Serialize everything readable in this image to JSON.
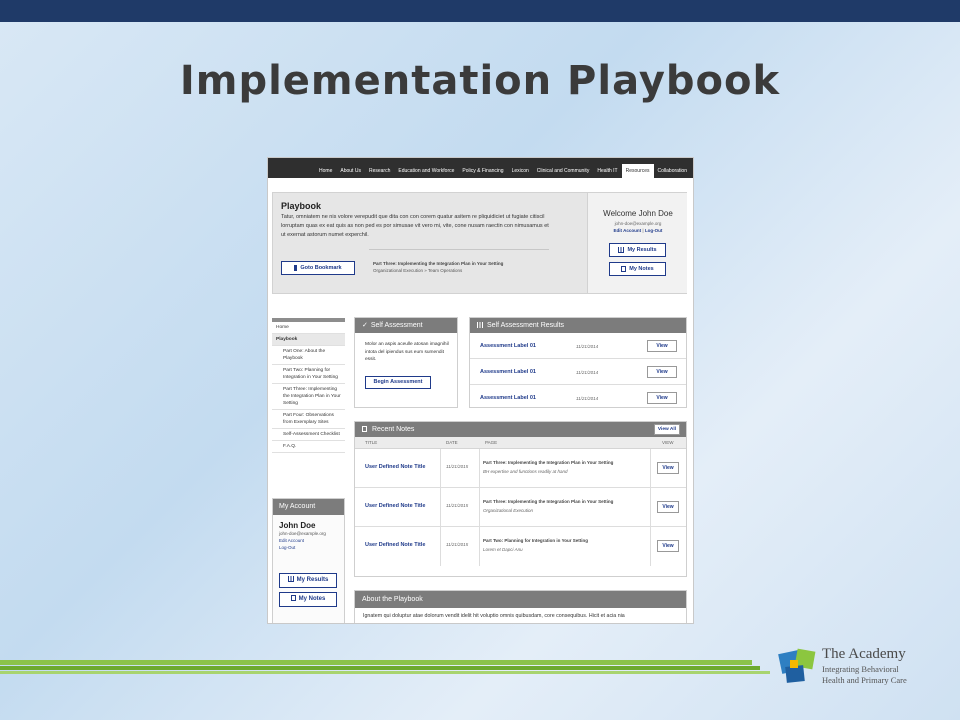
{
  "slide": {
    "title": "Implementation Playbook"
  },
  "nav": {
    "items": [
      "Home",
      "About Us",
      "Research",
      "Education and Workforce",
      "Policy & Financing",
      "Lexicon",
      "Clinical and Community",
      "Health IT",
      "Resources",
      "Collaboration"
    ],
    "active": "Resources"
  },
  "hero": {
    "title": "Playbook",
    "text": "Tatur, omniatem ne nis volore verepudit que dita con con corem quatur asitem re pliquidiciet ut fugiate citiscil lorruptam quas ex eat quis as non ped es por simusae vit vero mi, vite, cone nusam raectin con nimusamus et ut exernat astorum numet experchil.",
    "goto_bookmark": "Goto Bookmark",
    "bookmark_part": "Part Three: Implementing the Integration Plan in Your Setting",
    "bookmark_sub": "Organizational Execution » Team Operations"
  },
  "welcome": {
    "greeting": "Welcome John Doe",
    "email": "john-doe@example.org",
    "edit_account": "Edit Account",
    "separator": "|",
    "log_out": "Log-Out",
    "my_results": "My Results",
    "my_notes": "My Notes"
  },
  "sidebar": {
    "items": [
      {
        "label": "Home"
      },
      {
        "label": "Playbook"
      },
      {
        "label": "Part One: About the Playbook"
      },
      {
        "label": "Part Two: Planning for Integration in Your Setting"
      },
      {
        "label": "Part Three: Implementing the Integration Plan in Your Setting"
      },
      {
        "label": "Part Four: Observations from Exemplary Sites"
      },
      {
        "label": "Self-Assessment Checklist"
      },
      {
        "label": "F.A.Q."
      }
    ]
  },
  "account": {
    "heading": "My Account",
    "name": "John Doe",
    "email": "john-doe@example.org",
    "edit_account": "Edit Account",
    "log_out": "Log-Out",
    "my_results": "My Results",
    "my_notes": "My Notes"
  },
  "self_assessment": {
    "heading": "Self Assessment",
    "text": "Molor an aspis aceulle atosan imagnihil intota del ipiendus sus eum sumendit essit.",
    "button": "Begin Assessment"
  },
  "results": {
    "heading": "Self Assessment Results",
    "rows": [
      {
        "label": "Assessment Label 01",
        "date": "11/21/2014",
        "button": "View"
      },
      {
        "label": "Assessment Label 01",
        "date": "11/21/2014",
        "button": "View"
      },
      {
        "label": "Assessment Label 01",
        "date": "11/21/2014",
        "button": "View"
      }
    ]
  },
  "notes": {
    "heading": "Recent Notes",
    "view_all": "View All",
    "columns": [
      "TITLE",
      "DATE",
      "PAGE",
      "VIEW"
    ],
    "rows": [
      {
        "title": "User Defined Note Title",
        "date": "11/21/2015",
        "page": "Part Three: Implementing the Integration Plan in Your Setting",
        "sub": "BH expertise and functions readily at hand",
        "button": "View"
      },
      {
        "title": "User Defined Note Title",
        "date": "11/21/2015",
        "page": "Part Three: Implementing the Integration Plan in Your Setting",
        "sub": "Organizational Execution",
        "button": "View"
      },
      {
        "title": "User Defined Note Title",
        "date": "11/21/2015",
        "page": "Part Two: Planning for Integration in Your Setting",
        "sub": "Lorem et Dapci Anu",
        "button": "View"
      }
    ]
  },
  "about": {
    "heading": "About the Playbook",
    "text": "Ignatem qui doluptur atae dolorum vendit idelit hit voluptio omnis quibusdam, core consequibus. Hicit et acia nia"
  },
  "logo": {
    "name": "The Academy",
    "sub_line1": "Integrating Behavioral",
    "sub_line2": "Health and Primary Care"
  },
  "colors": {
    "topbar": "#1f3a68",
    "link": "#1f3a8a",
    "panel_head": "#7c7c7c",
    "stripe_green": "#8bc34a"
  }
}
